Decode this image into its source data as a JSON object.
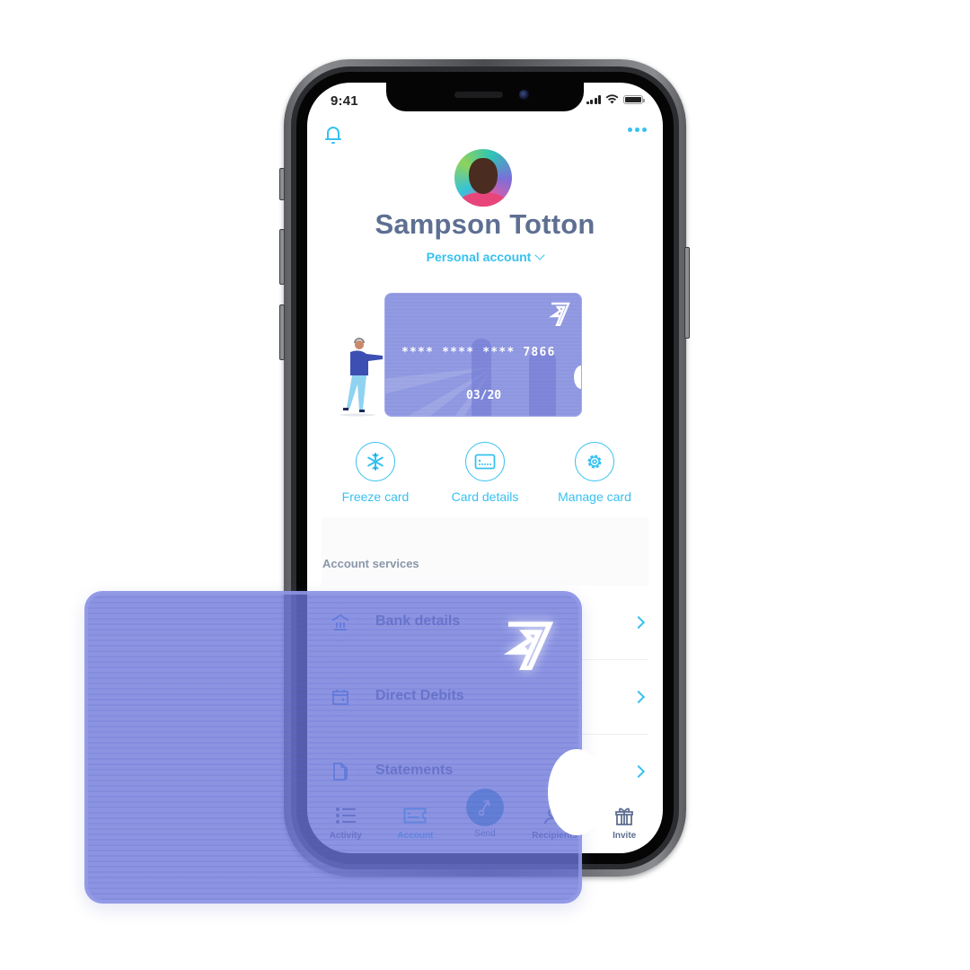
{
  "status_bar": {
    "time": "9:41"
  },
  "header": {
    "bell_icon": "bell-icon",
    "more_icon": "more-horizontal-icon"
  },
  "profile": {
    "name": "Sampson Totton",
    "account_type": "Personal account"
  },
  "card": {
    "number_masked": "**** **** **** 7866",
    "expiry": "03/20",
    "logo": "wise-logo"
  },
  "quick_actions": [
    {
      "label": "Freeze card",
      "icon": "snowflake-icon"
    },
    {
      "label": "Card details",
      "icon": "card-icon"
    },
    {
      "label": "Manage card",
      "icon": "gear-icon"
    }
  ],
  "services": {
    "title": "Account services",
    "items": [
      {
        "label": "Bank details",
        "icon": "bank-icon"
      },
      {
        "label": "Direct Debits",
        "icon": "calendar-icon"
      },
      {
        "label": "Statements",
        "icon": "document-icon"
      }
    ]
  },
  "tab_bar": {
    "active": "Account",
    "items": [
      {
        "label": "Activity",
        "icon": "list-icon"
      },
      {
        "label": "Account",
        "icon": "card-icon"
      },
      {
        "label": "Send",
        "icon": "send-arrow-icon"
      },
      {
        "label": "Recipients",
        "icon": "people-icon"
      },
      {
        "label": "Invite",
        "icon": "gift-icon"
      }
    ]
  },
  "colors": {
    "accent": "#37c1f0",
    "text_primary": "#5e6f92",
    "card": "#8e97e0",
    "send_button": "#3e9fc3"
  }
}
